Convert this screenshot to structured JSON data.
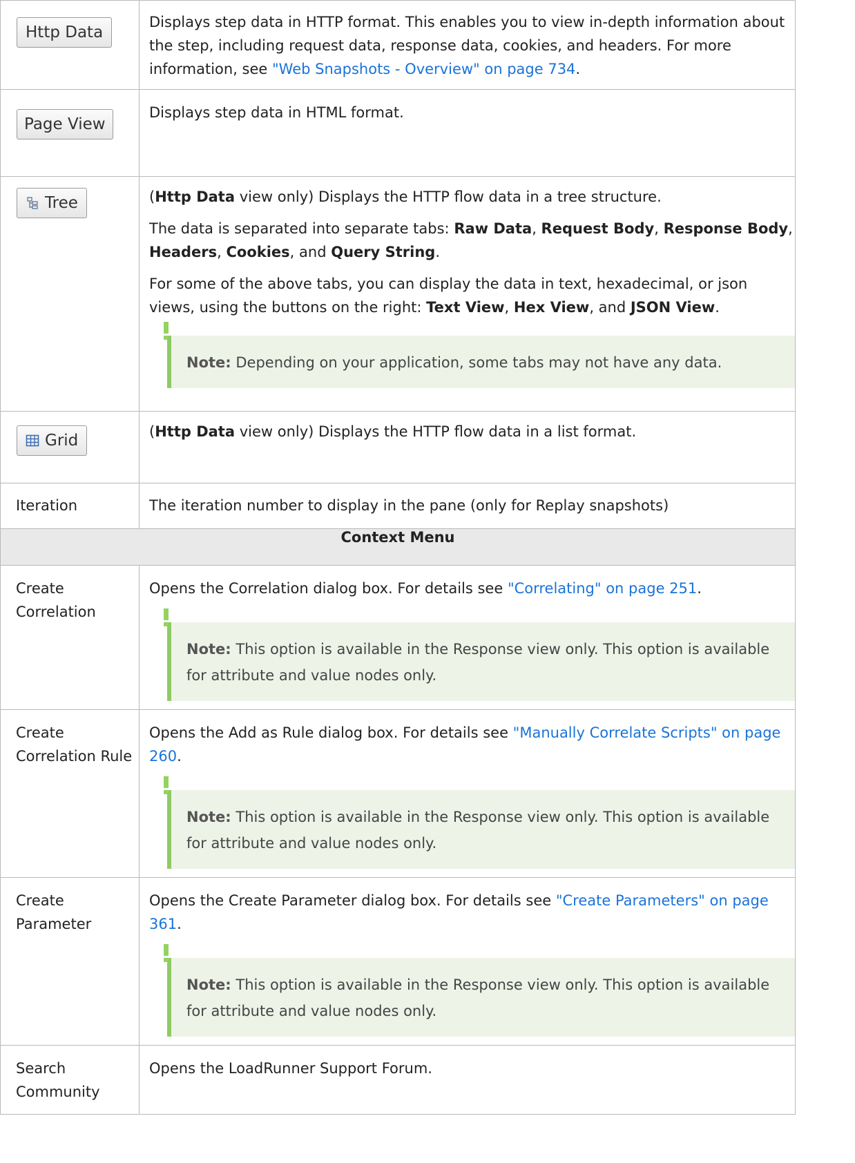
{
  "rows": [
    {
      "ui": "Http Data",
      "desc_parts": [
        "Displays step data in HTTP format. This enables you to view in-depth information about the step, including request data, response data, cookies, and headers. For more information, see ",
        "\"Web Snapshots - Overview\" on page 734",
        "."
      ]
    },
    {
      "ui": "Page View",
      "desc": "Displays step data in HTML format."
    },
    {
      "ui": "Tree",
      "icon": "tree-icon",
      "p1_bold": "Http Data",
      "p1_rest": " view only) Displays the HTTP flow data in a tree structure.",
      "p2_intro": "The data is separated into separate tabs: ",
      "p2_tabs": [
        "Raw Data",
        "Request Body",
        "Response Body",
        "Headers",
        "Cookies",
        "Query String"
      ],
      "p3_intro": "For some of the above tabs, you can display the data in text, hexadecimal, or json views, using the buttons on the right: ",
      "p3_views": [
        "Text View",
        "Hex View",
        "JSON View"
      ],
      "note_label": "Note:",
      "note_text": " Depending on your application, some tabs may not have any data."
    },
    {
      "ui": "Grid",
      "icon": "grid-icon",
      "p1_bold": "Http Data",
      "p1_rest": " view only) Displays the HTTP flow data in a list format."
    },
    {
      "ui": "Iteration",
      "desc": "The iteration number to display in the pane (only for Replay snapshots)"
    }
  ],
  "section_title": "Context Menu",
  "context_rows": [
    {
      "ui": "Create Correlation",
      "desc_intro": "Opens the Correlation dialog box. For details see ",
      "link": "\"Correlating\" on page 251",
      "note_label": "Note:",
      "note_text": " This option is available in the Response view only. This option is available for attribute and value nodes only."
    },
    {
      "ui": "Create Correlation Rule",
      "desc_intro": "Opens the Add as Rule dialog box. For details see ",
      "link": "\"Manually Correlate Scripts\" on page 260",
      "note_label": "Note:",
      "note_text": " This option is available in the Response view only. This option is available for attribute and value nodes only."
    },
    {
      "ui": "Create Parameter",
      "desc_intro": "Opens the Create Parameter dialog box. For details see ",
      "link": "\"Create Parameters\" on page 361",
      "note_label": "Note:",
      "note_text": " This option is available in the Response view only. This option is available for attribute and value nodes only."
    },
    {
      "ui": "Search Community",
      "desc": "Opens the LoadRunner Support Forum."
    }
  ]
}
